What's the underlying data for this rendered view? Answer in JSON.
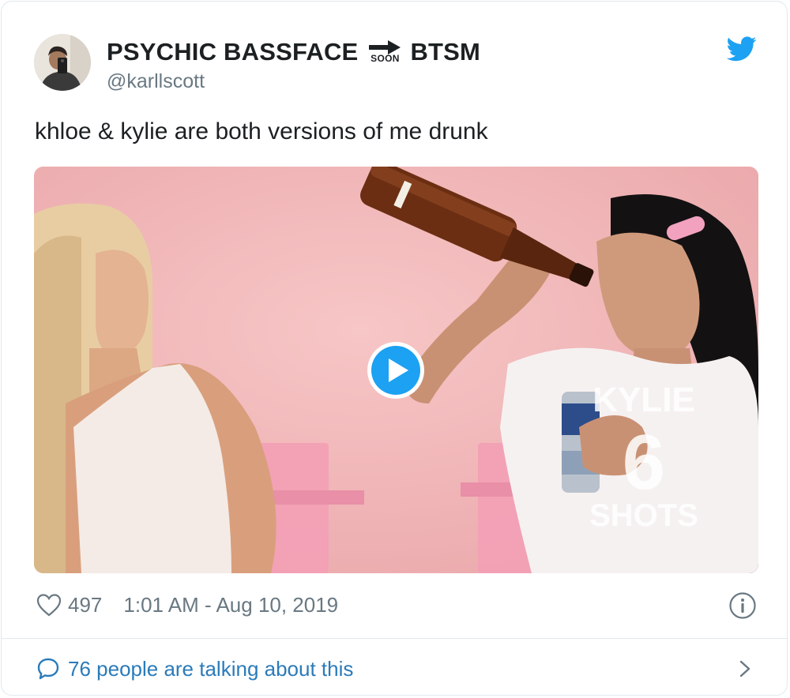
{
  "author": {
    "name_part1": "PSYCHIC BASSFACE",
    "soon_label": "SOON",
    "name_part2": "BTSM",
    "handle": "@karllscott"
  },
  "tweet": {
    "text": "khloe & kylie are both versions of me drunk"
  },
  "media": {
    "overlay_name": "KYLIE",
    "overlay_number": "6",
    "overlay_unit": "SHOTS"
  },
  "footer": {
    "likes": "497",
    "timestamp": "1:01 AM - Aug 10, 2019"
  },
  "conversation": {
    "label": "76 people are talking about this"
  },
  "colors": {
    "link_blue": "#2b7bb9",
    "twitter_blue": "#1da1f2",
    "meta_gray": "#697882",
    "border": "#e1e8ed"
  },
  "icons": [
    "twitter-bird-icon",
    "arrow-right-icon",
    "play-icon",
    "heart-icon",
    "info-icon",
    "speech-bubble-icon",
    "chevron-right-icon"
  ]
}
